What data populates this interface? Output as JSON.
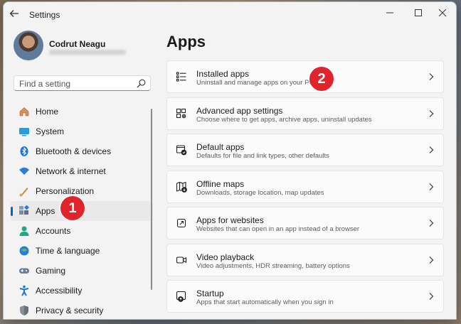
{
  "window": {
    "title": "Settings"
  },
  "user": {
    "name": "Codrut Neagu"
  },
  "search": {
    "placeholder": "Find a setting"
  },
  "nav": {
    "items": [
      {
        "label": "Home",
        "icon": "home-icon"
      },
      {
        "label": "System",
        "icon": "system-icon"
      },
      {
        "label": "Bluetooth & devices",
        "icon": "bluetooth-icon"
      },
      {
        "label": "Network & internet",
        "icon": "network-icon"
      },
      {
        "label": "Personalization",
        "icon": "personalization-icon"
      },
      {
        "label": "Apps",
        "icon": "apps-icon",
        "active": true
      },
      {
        "label": "Accounts",
        "icon": "accounts-icon"
      },
      {
        "label": "Time & language",
        "icon": "time-language-icon"
      },
      {
        "label": "Gaming",
        "icon": "gaming-icon"
      },
      {
        "label": "Accessibility",
        "icon": "accessibility-icon"
      },
      {
        "label": "Privacy & security",
        "icon": "privacy-security-icon"
      }
    ]
  },
  "main": {
    "title": "Apps",
    "cards": [
      {
        "title": "Installed apps",
        "subtitle": "Uninstall and manage apps on your PC",
        "icon": "installed-apps-icon"
      },
      {
        "title": "Advanced app settings",
        "subtitle": "Choose where to get apps, archive apps, uninstall updates",
        "icon": "advanced-app-settings-icon"
      },
      {
        "title": "Default apps",
        "subtitle": "Defaults for file and link types, other defaults",
        "icon": "default-apps-icon"
      },
      {
        "title": "Offline maps",
        "subtitle": "Downloads, storage location, map updates",
        "icon": "offline-maps-icon"
      },
      {
        "title": "Apps for websites",
        "subtitle": "Websites that can open in an app instead of a browser",
        "icon": "apps-for-websites-icon"
      },
      {
        "title": "Video playback",
        "subtitle": "Video adjustments, HDR streaming, battery options",
        "icon": "video-playback-icon"
      },
      {
        "title": "Startup",
        "subtitle": "Apps that start automatically when you sign in",
        "icon": "startup-icon"
      }
    ]
  },
  "annotations": {
    "badge1": "1",
    "badge2": "2",
    "color": "#e0242c"
  },
  "colors": {
    "accent": "#0067c0",
    "background": "#f3f3f3",
    "card": "#fbfbfb"
  }
}
